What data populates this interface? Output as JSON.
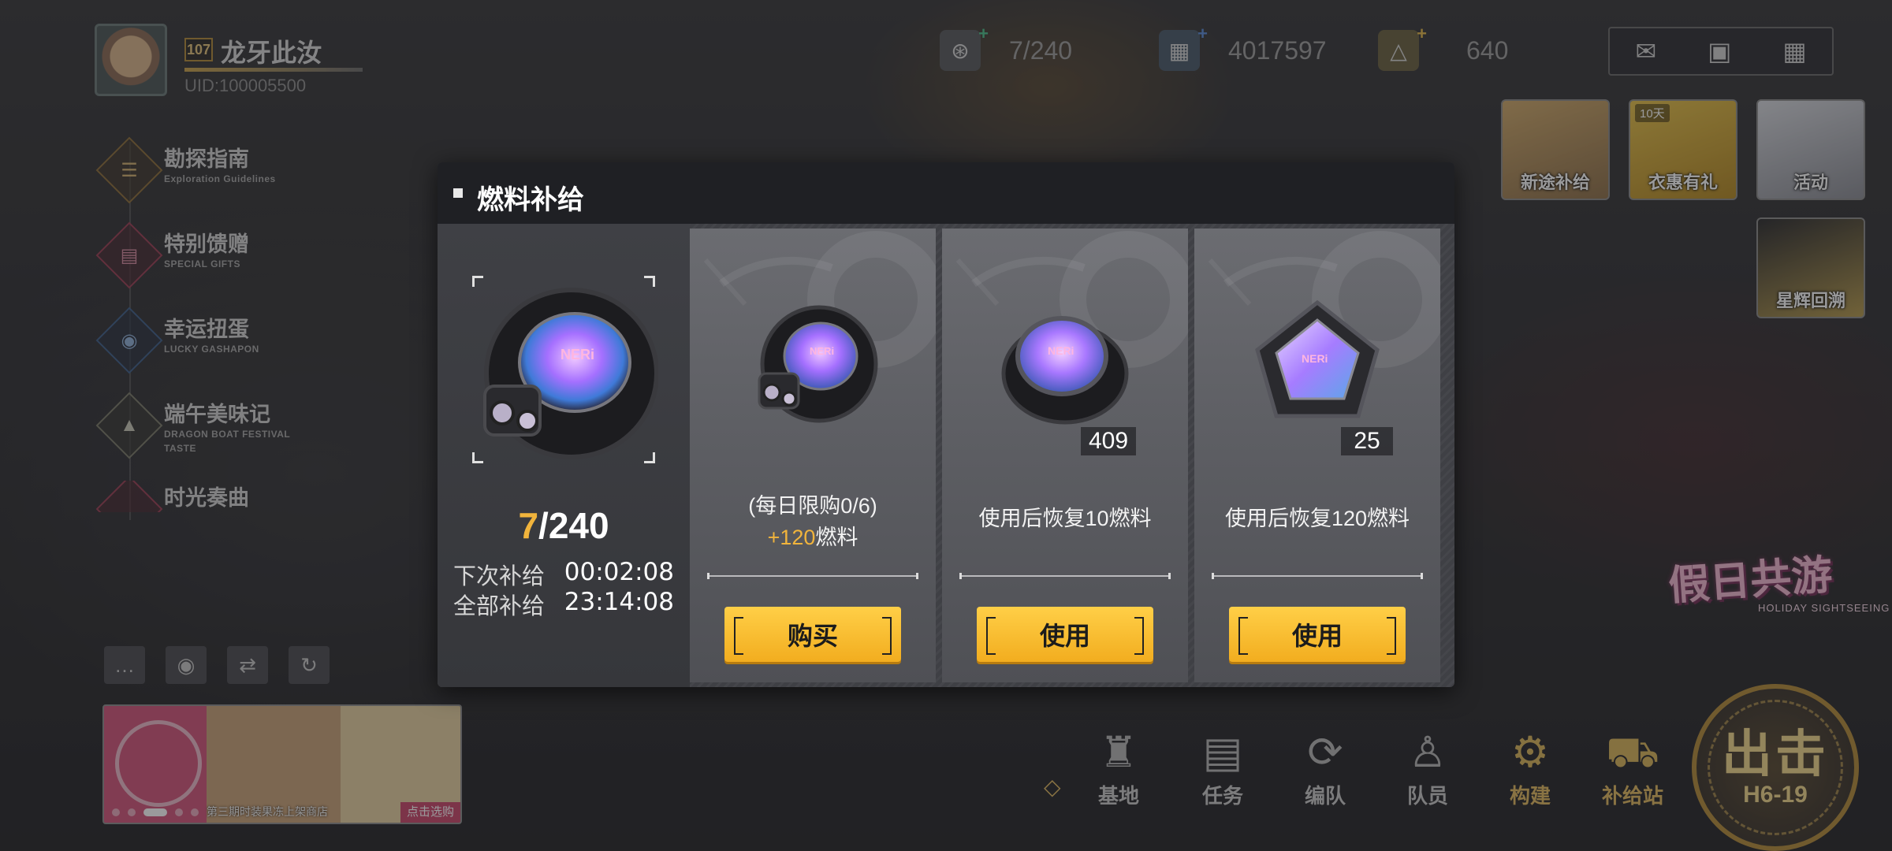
{
  "player": {
    "level": "107",
    "name": "龙牙此汝",
    "uid": "UID:100005500"
  },
  "resources": {
    "fuel": "7/240",
    "credits": "4017597",
    "gems": "640"
  },
  "left_menu": [
    {
      "title": "勘探指南",
      "subtitle": "Exploration Guidelines",
      "icon": "compass-icon"
    },
    {
      "title": "特别馈赠",
      "subtitle": "SPECIAL GIFTS",
      "icon": "gift-icon"
    },
    {
      "title": "幸运扭蛋",
      "subtitle": "LUCKY GASHAPON",
      "icon": "gashapon-icon"
    },
    {
      "title": "端午美味记",
      "subtitle": "DRAGON BOAT FESTIVAL TASTE",
      "icon": "festival-icon"
    },
    {
      "title": "时光奏曲",
      "subtitle": "",
      "icon": "music-icon"
    }
  ],
  "banner": {
    "caption": "第三期时装果冻上架商店",
    "tag": "点击选购"
  },
  "event_tiles": [
    {
      "label": "新途补给",
      "timer": ""
    },
    {
      "label": "衣惠有礼",
      "timer": "10天"
    },
    {
      "label": "活动",
      "timer": ""
    },
    {
      "label": "星辉回溯",
      "timer": ""
    }
  ],
  "event_logo": {
    "title": "假日共游",
    "subtitle": "HOLIDAY SIGHTSEEING"
  },
  "bottom_nav": [
    {
      "label": "基地",
      "icon": "base-icon"
    },
    {
      "label": "任务",
      "icon": "tasks-icon"
    },
    {
      "label": "编队",
      "icon": "formation-icon"
    },
    {
      "label": "队员",
      "icon": "members-icon"
    },
    {
      "label": "构建",
      "icon": "build-icon"
    },
    {
      "label": "补给站",
      "icon": "supply-cart-icon"
    }
  ],
  "sortie": {
    "title": "出击",
    "stage": "H6-19"
  },
  "modal": {
    "title": "燃料补给",
    "status": {
      "current": "7",
      "max": "240",
      "next_label": "下次补给",
      "next_time": "00:02:08",
      "full_label": "全部补给",
      "full_time": "23:14:08"
    },
    "cards": [
      {
        "desc": "(每日限购0/6)",
        "bonus_amount": "+120",
        "bonus_unit": "燃料",
        "quantity": "",
        "button": "购买"
      },
      {
        "desc": "使用后恢复10燃料",
        "bonus_amount": "",
        "bonus_unit": "",
        "quantity": "409",
        "button": "使用"
      },
      {
        "desc": "使用后恢复120燃料",
        "bonus_amount": "",
        "bonus_unit": "",
        "quantity": "25",
        "button": "使用"
      }
    ]
  },
  "colors": {
    "accent_gold": "#f1b43c",
    "button_yellow": "#ffcf47",
    "modal_header": "#1f2024"
  }
}
